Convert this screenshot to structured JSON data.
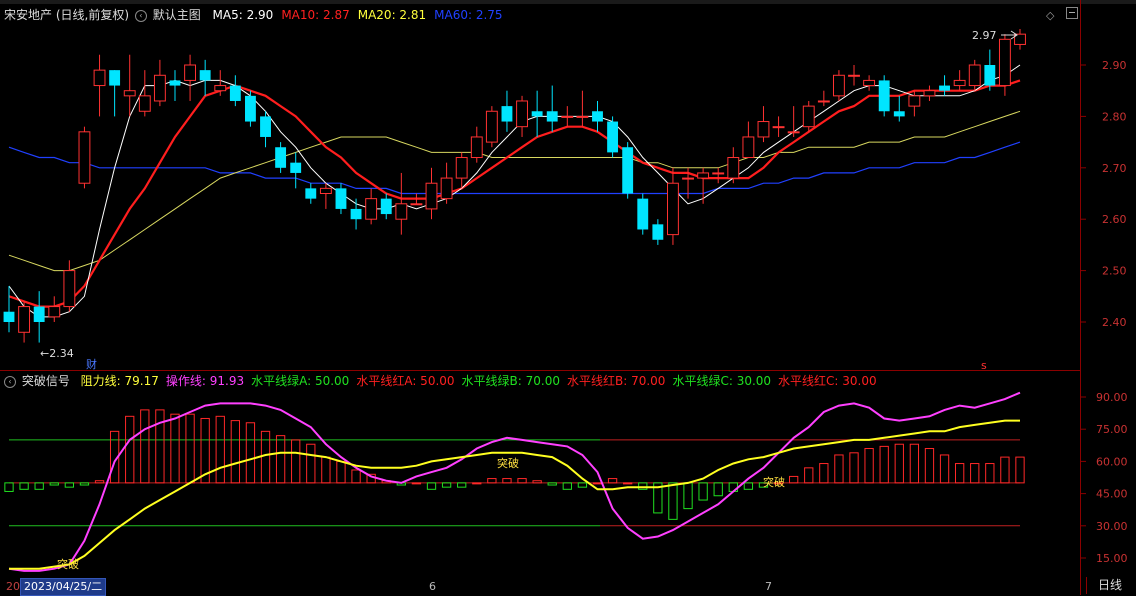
{
  "stock": {
    "name": "宋安地产",
    "mode": "(日线,前复权)",
    "main_label": "默认主图",
    "ma": [
      {
        "label": "MA5:",
        "value": "2.90",
        "color": "#ffffff"
      },
      {
        "label": "MA10:",
        "value": "2.87",
        "color": "#ff2020"
      },
      {
        "label": "MA20:",
        "value": "2.81",
        "color": "#ffff3c"
      },
      {
        "label": "MA60:",
        "value": "2.75",
        "color": "#2040ff"
      }
    ]
  },
  "price_axis": [
    "2.90",
    "2.80",
    "2.70",
    "2.60",
    "2.50",
    "2.40"
  ],
  "price_marks": {
    "high_label": "2.97",
    "low_label": "←2.34",
    "cai": "财",
    "s_mark": "s"
  },
  "indicator": {
    "name": "突破信号",
    "params": [
      {
        "label": "阻力线:",
        "value": "79.17",
        "color": "#ffff3c"
      },
      {
        "label": "操作线:",
        "value": "91.93",
        "color": "#ff40ff"
      },
      {
        "label": "水平线绿A:",
        "value": "50.00",
        "color": "#20e020"
      },
      {
        "label": "水平线红A:",
        "value": "50.00",
        "color": "#ff2020"
      },
      {
        "label": "水平线绿B:",
        "value": "70.00",
        "color": "#20e020"
      },
      {
        "label": "水平线红B:",
        "value": "70.00",
        "color": "#ff2020"
      },
      {
        "label": "水平线绿C:",
        "value": "30.00",
        "color": "#20e020"
      },
      {
        "label": "水平线红C:",
        "value": "30.00",
        "color": "#ff2020"
      }
    ],
    "axis": [
      "90.00",
      "75.00",
      "60.00",
      "45.00",
      "30.00",
      "15.00"
    ],
    "signals": [
      "突破",
      "突破",
      "突破"
    ]
  },
  "dates": {
    "selected": "2023/04/25/二",
    "ticks": [
      "6",
      "7"
    ],
    "left_stub": "20"
  },
  "period": "日线",
  "chart_data": [
    {
      "type": "candlestick",
      "title": "宋安地产 (日线,前复权)",
      "y_ticks": [
        2.9,
        2.8,
        2.7,
        2.6,
        2.5,
        2.4
      ],
      "ylim": [
        2.3,
        3.01
      ],
      "candles": [
        [
          2.42,
          2.4,
          2.47,
          2.38
        ],
        [
          2.38,
          2.43,
          2.44,
          2.36
        ],
        [
          2.43,
          2.4,
          2.46,
          2.36
        ],
        [
          2.41,
          2.43,
          2.45,
          2.4
        ],
        [
          2.43,
          2.5,
          2.52,
          2.42
        ],
        [
          2.67,
          2.77,
          2.78,
          2.66
        ],
        [
          2.86,
          2.89,
          2.92,
          2.8
        ],
        [
          2.89,
          2.86,
          2.89,
          2.8
        ],
        [
          2.84,
          2.85,
          2.92,
          2.8
        ],
        [
          2.81,
          2.84,
          2.89,
          2.8
        ],
        [
          2.83,
          2.88,
          2.91,
          2.82
        ],
        [
          2.87,
          2.86,
          2.89,
          2.83
        ],
        [
          2.87,
          2.9,
          2.92,
          2.83
        ],
        [
          2.89,
          2.87,
          2.91,
          2.84
        ],
        [
          2.85,
          2.86,
          2.89,
          2.84
        ],
        [
          2.86,
          2.83,
          2.88,
          2.82
        ],
        [
          2.84,
          2.79,
          2.85,
          2.78
        ],
        [
          2.8,
          2.76,
          2.81,
          2.74
        ],
        [
          2.74,
          2.7,
          2.75,
          2.69
        ],
        [
          2.71,
          2.69,
          2.73,
          2.66
        ],
        [
          2.66,
          2.64,
          2.67,
          2.63
        ],
        [
          2.65,
          2.66,
          2.67,
          2.62
        ],
        [
          2.66,
          2.62,
          2.67,
          2.61
        ],
        [
          2.62,
          2.6,
          2.64,
          2.58
        ],
        [
          2.6,
          2.64,
          2.66,
          2.59
        ],
        [
          2.64,
          2.61,
          2.65,
          2.6
        ],
        [
          2.6,
          2.63,
          2.69,
          2.57
        ],
        [
          2.63,
          2.63,
          2.65,
          2.63
        ],
        [
          2.62,
          2.67,
          2.7,
          2.6
        ],
        [
          2.64,
          2.68,
          2.71,
          2.63
        ],
        [
          2.68,
          2.72,
          2.73,
          2.66
        ],
        [
          2.72,
          2.76,
          2.78,
          2.71
        ],
        [
          2.75,
          2.81,
          2.82,
          2.74
        ],
        [
          2.82,
          2.79,
          2.85,
          2.77
        ],
        [
          2.78,
          2.83,
          2.84,
          2.76
        ],
        [
          2.81,
          2.8,
          2.85,
          2.76
        ],
        [
          2.81,
          2.79,
          2.86,
          2.77
        ],
        [
          2.8,
          2.8,
          2.82,
          2.78
        ],
        [
          2.8,
          2.8,
          2.85,
          2.78
        ],
        [
          2.81,
          2.79,
          2.83,
          2.77
        ],
        [
          2.79,
          2.73,
          2.8,
          2.72
        ],
        [
          2.74,
          2.65,
          2.75,
          2.64
        ],
        [
          2.64,
          2.58,
          2.65,
          2.57
        ],
        [
          2.59,
          2.56,
          2.6,
          2.55
        ],
        [
          2.57,
          2.67,
          2.7,
          2.55
        ],
        [
          2.68,
          2.68,
          2.7,
          2.64
        ],
        [
          2.68,
          2.69,
          2.7,
          2.63
        ],
        [
          2.69,
          2.69,
          2.7,
          2.67
        ],
        [
          2.68,
          2.72,
          2.74,
          2.67
        ],
        [
          2.72,
          2.76,
          2.79,
          2.72
        ],
        [
          2.76,
          2.79,
          2.82,
          2.75
        ],
        [
          2.78,
          2.78,
          2.8,
          2.76
        ],
        [
          2.77,
          2.77,
          2.82,
          2.76
        ],
        [
          2.78,
          2.82,
          2.83,
          2.77
        ],
        [
          2.83,
          2.83,
          2.85,
          2.82
        ],
        [
          2.84,
          2.88,
          2.89,
          2.83
        ],
        [
          2.88,
          2.88,
          2.9,
          2.86
        ],
        [
          2.86,
          2.87,
          2.88,
          2.85
        ],
        [
          2.87,
          2.81,
          2.88,
          2.8
        ],
        [
          2.81,
          2.8,
          2.84,
          2.79
        ],
        [
          2.82,
          2.84,
          2.85,
          2.8
        ],
        [
          2.84,
          2.85,
          2.86,
          2.83
        ],
        [
          2.86,
          2.85,
          2.88,
          2.84
        ],
        [
          2.86,
          2.87,
          2.89,
          2.85
        ],
        [
          2.86,
          2.9,
          2.91,
          2.85
        ],
        [
          2.9,
          2.86,
          2.93,
          2.85
        ],
        [
          2.86,
          2.95,
          2.96,
          2.84
        ],
        [
          2.94,
          2.96,
          2.97,
          2.93
        ]
      ],
      "ma5": [
        2.47,
        2.43,
        2.41,
        2.41,
        2.42,
        2.45,
        2.58,
        2.7,
        2.8,
        2.86,
        2.86,
        2.87,
        2.86,
        2.87,
        2.87,
        2.86,
        2.84,
        2.81,
        2.77,
        2.74,
        2.7,
        2.67,
        2.65,
        2.63,
        2.62,
        2.62,
        2.63,
        2.62,
        2.63,
        2.64,
        2.66,
        2.69,
        2.73,
        2.76,
        2.79,
        2.8,
        2.8,
        2.8,
        2.8,
        2.8,
        2.79,
        2.76,
        2.72,
        2.69,
        2.66,
        2.63,
        2.64,
        2.66,
        2.68,
        2.7,
        2.73,
        2.75,
        2.77,
        2.79,
        2.81,
        2.83,
        2.85,
        2.86,
        2.86,
        2.85,
        2.84,
        2.84,
        2.84,
        2.84,
        2.85,
        2.87,
        2.88,
        2.9
      ],
      "ma10": [
        2.45,
        2.44,
        2.43,
        2.43,
        2.44,
        2.47,
        2.52,
        2.57,
        2.62,
        2.66,
        2.71,
        2.76,
        2.8,
        2.84,
        2.85,
        2.86,
        2.85,
        2.84,
        2.82,
        2.8,
        2.77,
        2.74,
        2.72,
        2.69,
        2.67,
        2.65,
        2.64,
        2.64,
        2.64,
        2.65,
        2.66,
        2.68,
        2.7,
        2.72,
        2.74,
        2.76,
        2.77,
        2.78,
        2.78,
        2.77,
        2.75,
        2.73,
        2.71,
        2.7,
        2.69,
        2.69,
        2.68,
        2.68,
        2.68,
        2.68,
        2.7,
        2.73,
        2.75,
        2.77,
        2.79,
        2.81,
        2.82,
        2.84,
        2.84,
        2.84,
        2.85,
        2.85,
        2.85,
        2.85,
        2.85,
        2.86,
        2.86,
        2.87
      ],
      "ma20": [
        2.53,
        2.52,
        2.51,
        2.5,
        2.5,
        2.51,
        2.52,
        2.54,
        2.56,
        2.58,
        2.6,
        2.62,
        2.64,
        2.66,
        2.68,
        2.69,
        2.7,
        2.71,
        2.72,
        2.73,
        2.74,
        2.75,
        2.76,
        2.76,
        2.76,
        2.76,
        2.75,
        2.74,
        2.73,
        2.73,
        2.73,
        2.73,
        2.72,
        2.72,
        2.72,
        2.72,
        2.72,
        2.72,
        2.72,
        2.72,
        2.72,
        2.72,
        2.71,
        2.71,
        2.7,
        2.7,
        2.7,
        2.7,
        2.71,
        2.72,
        2.72,
        2.73,
        2.73,
        2.74,
        2.74,
        2.74,
        2.74,
        2.75,
        2.75,
        2.75,
        2.76,
        2.76,
        2.76,
        2.77,
        2.78,
        2.79,
        2.8,
        2.81
      ],
      "ma60": [
        2.74,
        2.73,
        2.72,
        2.72,
        2.71,
        2.71,
        2.7,
        2.7,
        2.7,
        2.7,
        2.7,
        2.7,
        2.7,
        2.7,
        2.69,
        2.69,
        2.69,
        2.68,
        2.68,
        2.68,
        2.67,
        2.67,
        2.67,
        2.66,
        2.66,
        2.66,
        2.65,
        2.65,
        2.65,
        2.65,
        2.65,
        2.65,
        2.65,
        2.65,
        2.65,
        2.65,
        2.65,
        2.65,
        2.65,
        2.65,
        2.65,
        2.65,
        2.65,
        2.65,
        2.65,
        2.65,
        2.65,
        2.66,
        2.66,
        2.66,
        2.67,
        2.67,
        2.68,
        2.68,
        2.69,
        2.69,
        2.69,
        2.7,
        2.7,
        2.7,
        2.71,
        2.71,
        2.71,
        2.72,
        2.72,
        2.73,
        2.74,
        2.75
      ]
    },
    {
      "type": "bar+line",
      "title": "突破信号",
      "y_ticks": [
        90,
        75,
        60,
        45,
        30,
        15
      ],
      "ylim": [
        5,
        100
      ],
      "hlines": {
        "green": [
          70,
          50,
          30
        ],
        "red": [
          70,
          50,
          30
        ]
      },
      "bars": [
        46,
        47,
        47,
        49,
        48,
        49,
        51,
        74,
        81,
        84,
        84,
        82,
        82,
        80,
        81,
        79,
        78,
        74,
        72,
        70,
        68,
        62,
        60,
        56,
        54,
        51,
        49,
        50,
        47,
        48,
        48,
        50,
        52,
        52,
        52,
        51,
        49,
        47,
        48,
        50,
        52,
        50,
        47,
        36,
        33,
        38,
        42,
        44,
        46,
        47,
        48,
        50,
        53,
        57,
        59,
        63,
        64,
        66,
        67,
        68,
        68,
        66,
        63,
        59,
        59,
        59,
        62,
        62
      ],
      "resistance": [
        10,
        10,
        10,
        11,
        12,
        16,
        22,
        28,
        33,
        38,
        42,
        46,
        50,
        54,
        57,
        59,
        61,
        63,
        64,
        64,
        63,
        62,
        60,
        58,
        57,
        57,
        57,
        58,
        60,
        61,
        62,
        63,
        64,
        64,
        64,
        63,
        62,
        58,
        52,
        47,
        47,
        48,
        48,
        48,
        49,
        50,
        52,
        56,
        59,
        61,
        62,
        64,
        66,
        67,
        68,
        69,
        70,
        70,
        71,
        72,
        73,
        74,
        74,
        76,
        77,
        78,
        79,
        79
      ],
      "operation": [
        10,
        9,
        9,
        10,
        12,
        23,
        40,
        60,
        70,
        75,
        78,
        80,
        83,
        86,
        87,
        87,
        87,
        86,
        84,
        80,
        76,
        68,
        62,
        57,
        53,
        51,
        50,
        53,
        55,
        57,
        61,
        66,
        69,
        71,
        70,
        69,
        68,
        67,
        63,
        55,
        38,
        29,
        24,
        25,
        28,
        32,
        36,
        40,
        46,
        52,
        57,
        64,
        71,
        76,
        83,
        86,
        87,
        85,
        80,
        79,
        80,
        81,
        84,
        86,
        85,
        87,
        89,
        92
      ]
    }
  ]
}
